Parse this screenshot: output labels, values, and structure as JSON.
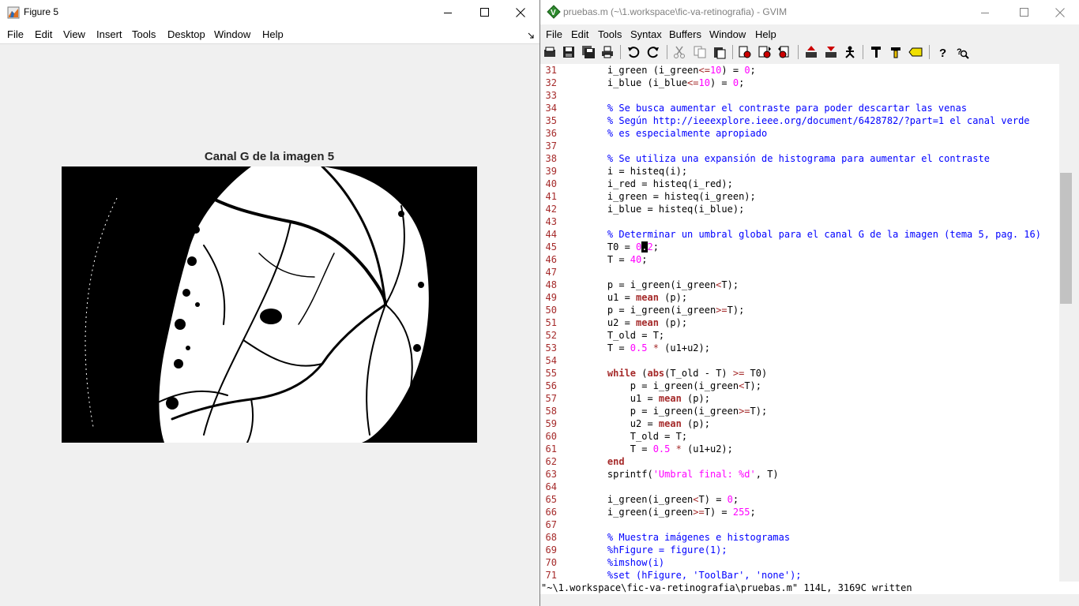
{
  "figure": {
    "title": "Figure 5",
    "menu": [
      "File",
      "Edit",
      "View",
      "Insert",
      "Tools",
      "Desktop",
      "Window",
      "Help"
    ],
    "axes_title": "Canal G de la imagen 5"
  },
  "gvim": {
    "title": "pruebas.m (~\\1.workspace\\fic-va-retinografia) - GVIM",
    "menu": [
      "File",
      "Edit",
      "Tools",
      "Syntax",
      "Buffers",
      "Window",
      "Help"
    ],
    "toolbar": [
      "open-icon",
      "save-icon",
      "save-all-icon",
      "print-icon",
      "undo-icon",
      "redo-icon",
      "cut-icon",
      "copy-icon",
      "paste-icon",
      "find-replace-icon",
      "find-next-icon",
      "find-prev-icon",
      "load-session-icon",
      "save-session-icon",
      "run-script-icon",
      "make-icon",
      "run-ctags-icon",
      "jump-tag-icon",
      "help-icon",
      "find-help-icon"
    ],
    "lines": [
      {
        "n": "31",
        "t": [
          [
            "",
            "    i_green (i_green"
          ],
          [
            "op",
            "<="
          ],
          [
            "num",
            "10"
          ],
          [
            "",
            ") = "
          ],
          [
            "num",
            "0"
          ],
          [
            "",
            ";"
          ]
        ]
      },
      {
        "n": "32",
        "t": [
          [
            "",
            "    i_blue (i_blue"
          ],
          [
            "op",
            "<="
          ],
          [
            "num",
            "10"
          ],
          [
            "",
            ") = "
          ],
          [
            "num",
            "0"
          ],
          [
            "",
            ";"
          ]
        ]
      },
      {
        "n": "33",
        "t": []
      },
      {
        "n": "34",
        "t": [
          [
            "cmt",
            "    % Se busca aumentar el contraste para poder descartar las venas"
          ]
        ]
      },
      {
        "n": "35",
        "t": [
          [
            "cmt",
            "    % Según http://ieeexplore.ieee.org/document/6428782/?part=1 el canal verde"
          ]
        ]
      },
      {
        "n": "36",
        "t": [
          [
            "cmt",
            "    % es especialmente apropiado"
          ]
        ]
      },
      {
        "n": "37",
        "t": []
      },
      {
        "n": "38",
        "t": [
          [
            "cmt",
            "    % Se utiliza una expansión de histograma para aumentar el contraste"
          ]
        ]
      },
      {
        "n": "39",
        "t": [
          [
            "",
            "    i = histeq(i);"
          ]
        ]
      },
      {
        "n": "40",
        "t": [
          [
            "",
            "    i_red = histeq(i_red);"
          ]
        ]
      },
      {
        "n": "41",
        "t": [
          [
            "",
            "    i_green = histeq(i_green);"
          ]
        ]
      },
      {
        "n": "42",
        "t": [
          [
            "",
            "    i_blue = histeq(i_blue);"
          ]
        ]
      },
      {
        "n": "43",
        "t": []
      },
      {
        "n": "44",
        "t": [
          [
            "cmt",
            "    % Determinar un umbral global para el canal G de la imagen (tema 5, pag. 16)"
          ]
        ]
      },
      {
        "n": "45",
        "t": [
          [
            "",
            "    T0 = "
          ],
          [
            "num",
            "0"
          ],
          [
            "cursor",
            "."
          ],
          [
            "num",
            "2"
          ],
          [
            "",
            ";"
          ]
        ]
      },
      {
        "n": "46",
        "t": [
          [
            "",
            "    T = "
          ],
          [
            "num",
            "40"
          ],
          [
            "",
            ";"
          ]
        ]
      },
      {
        "n": "47",
        "t": []
      },
      {
        "n": "48",
        "t": [
          [
            "",
            "    p = i_green(i_green"
          ],
          [
            "op",
            "<"
          ],
          [
            "",
            "T);"
          ]
        ]
      },
      {
        "n": "49",
        "t": [
          [
            "",
            "    u1 = "
          ],
          [
            "kw",
            "mean"
          ],
          [
            "",
            " (p);"
          ]
        ]
      },
      {
        "n": "50",
        "t": [
          [
            "",
            "    p = i_green(i_green"
          ],
          [
            "op",
            ">="
          ],
          [
            "",
            "T);"
          ]
        ]
      },
      {
        "n": "51",
        "t": [
          [
            "",
            "    u2 = "
          ],
          [
            "kw",
            "mean"
          ],
          [
            "",
            " (p);"
          ]
        ]
      },
      {
        "n": "52",
        "t": [
          [
            "",
            "    T_old = T;"
          ]
        ]
      },
      {
        "n": "53",
        "t": [
          [
            "",
            "    T = "
          ],
          [
            "num",
            "0.5"
          ],
          [
            "op",
            " * "
          ],
          [
            "",
            "(u1+u2);"
          ]
        ]
      },
      {
        "n": "54",
        "t": []
      },
      {
        "n": "55",
        "t": [
          [
            "",
            "    "
          ],
          [
            "kw",
            "while"
          ],
          [
            "",
            " ("
          ],
          [
            "kw",
            "abs"
          ],
          [
            "",
            "(T_old - T) "
          ],
          [
            "op",
            ">="
          ],
          [
            "",
            " T0)"
          ]
        ]
      },
      {
        "n": "56",
        "t": [
          [
            "",
            "        p = i_green(i_green"
          ],
          [
            "op",
            "<"
          ],
          [
            "",
            "T);"
          ]
        ]
      },
      {
        "n": "57",
        "t": [
          [
            "",
            "        u1 = "
          ],
          [
            "kw",
            "mean"
          ],
          [
            "",
            " (p);"
          ]
        ]
      },
      {
        "n": "58",
        "t": [
          [
            "",
            "        p = i_green(i_green"
          ],
          [
            "op",
            ">="
          ],
          [
            "",
            "T);"
          ]
        ]
      },
      {
        "n": "59",
        "t": [
          [
            "",
            "        u2 = "
          ],
          [
            "kw",
            "mean"
          ],
          [
            "",
            " (p);"
          ]
        ]
      },
      {
        "n": "60",
        "t": [
          [
            "",
            "        T_old = T;"
          ]
        ]
      },
      {
        "n": "61",
        "t": [
          [
            "",
            "        T = "
          ],
          [
            "num",
            "0.5"
          ],
          [
            "op",
            " * "
          ],
          [
            "",
            "(u1+u2);"
          ]
        ]
      },
      {
        "n": "62",
        "t": [
          [
            "kw",
            "    end"
          ]
        ]
      },
      {
        "n": "63",
        "t": [
          [
            "",
            "    sprintf("
          ],
          [
            "str",
            "'Umbral final: %d'"
          ],
          [
            "",
            ", T)"
          ]
        ]
      },
      {
        "n": "64",
        "t": []
      },
      {
        "n": "65",
        "t": [
          [
            "",
            "    i_green(i_green"
          ],
          [
            "op",
            "<"
          ],
          [
            "",
            "T) = "
          ],
          [
            "num",
            "0"
          ],
          [
            "",
            ";"
          ]
        ]
      },
      {
        "n": "66",
        "t": [
          [
            "",
            "    i_green(i_green"
          ],
          [
            "op",
            ">="
          ],
          [
            "",
            "T) = "
          ],
          [
            "num",
            "255"
          ],
          [
            "",
            ";"
          ]
        ]
      },
      {
        "n": "67",
        "t": []
      },
      {
        "n": "68",
        "t": [
          [
            "cmt",
            "    % Muestra imágenes e histogramas"
          ]
        ]
      },
      {
        "n": "69",
        "t": [
          [
            "cmt",
            "    %hFigure = figure(1);"
          ]
        ]
      },
      {
        "n": "70",
        "t": [
          [
            "cmt",
            "    %imshow(i)"
          ]
        ]
      },
      {
        "n": "71",
        "t": [
          [
            "cmt",
            "    %set (hFigure, 'ToolBar', 'none');"
          ]
        ]
      }
    ],
    "status": "\"~\\1.workspace\\fic-va-retinografia\\pruebas.m\" 114L, 3169C written"
  }
}
